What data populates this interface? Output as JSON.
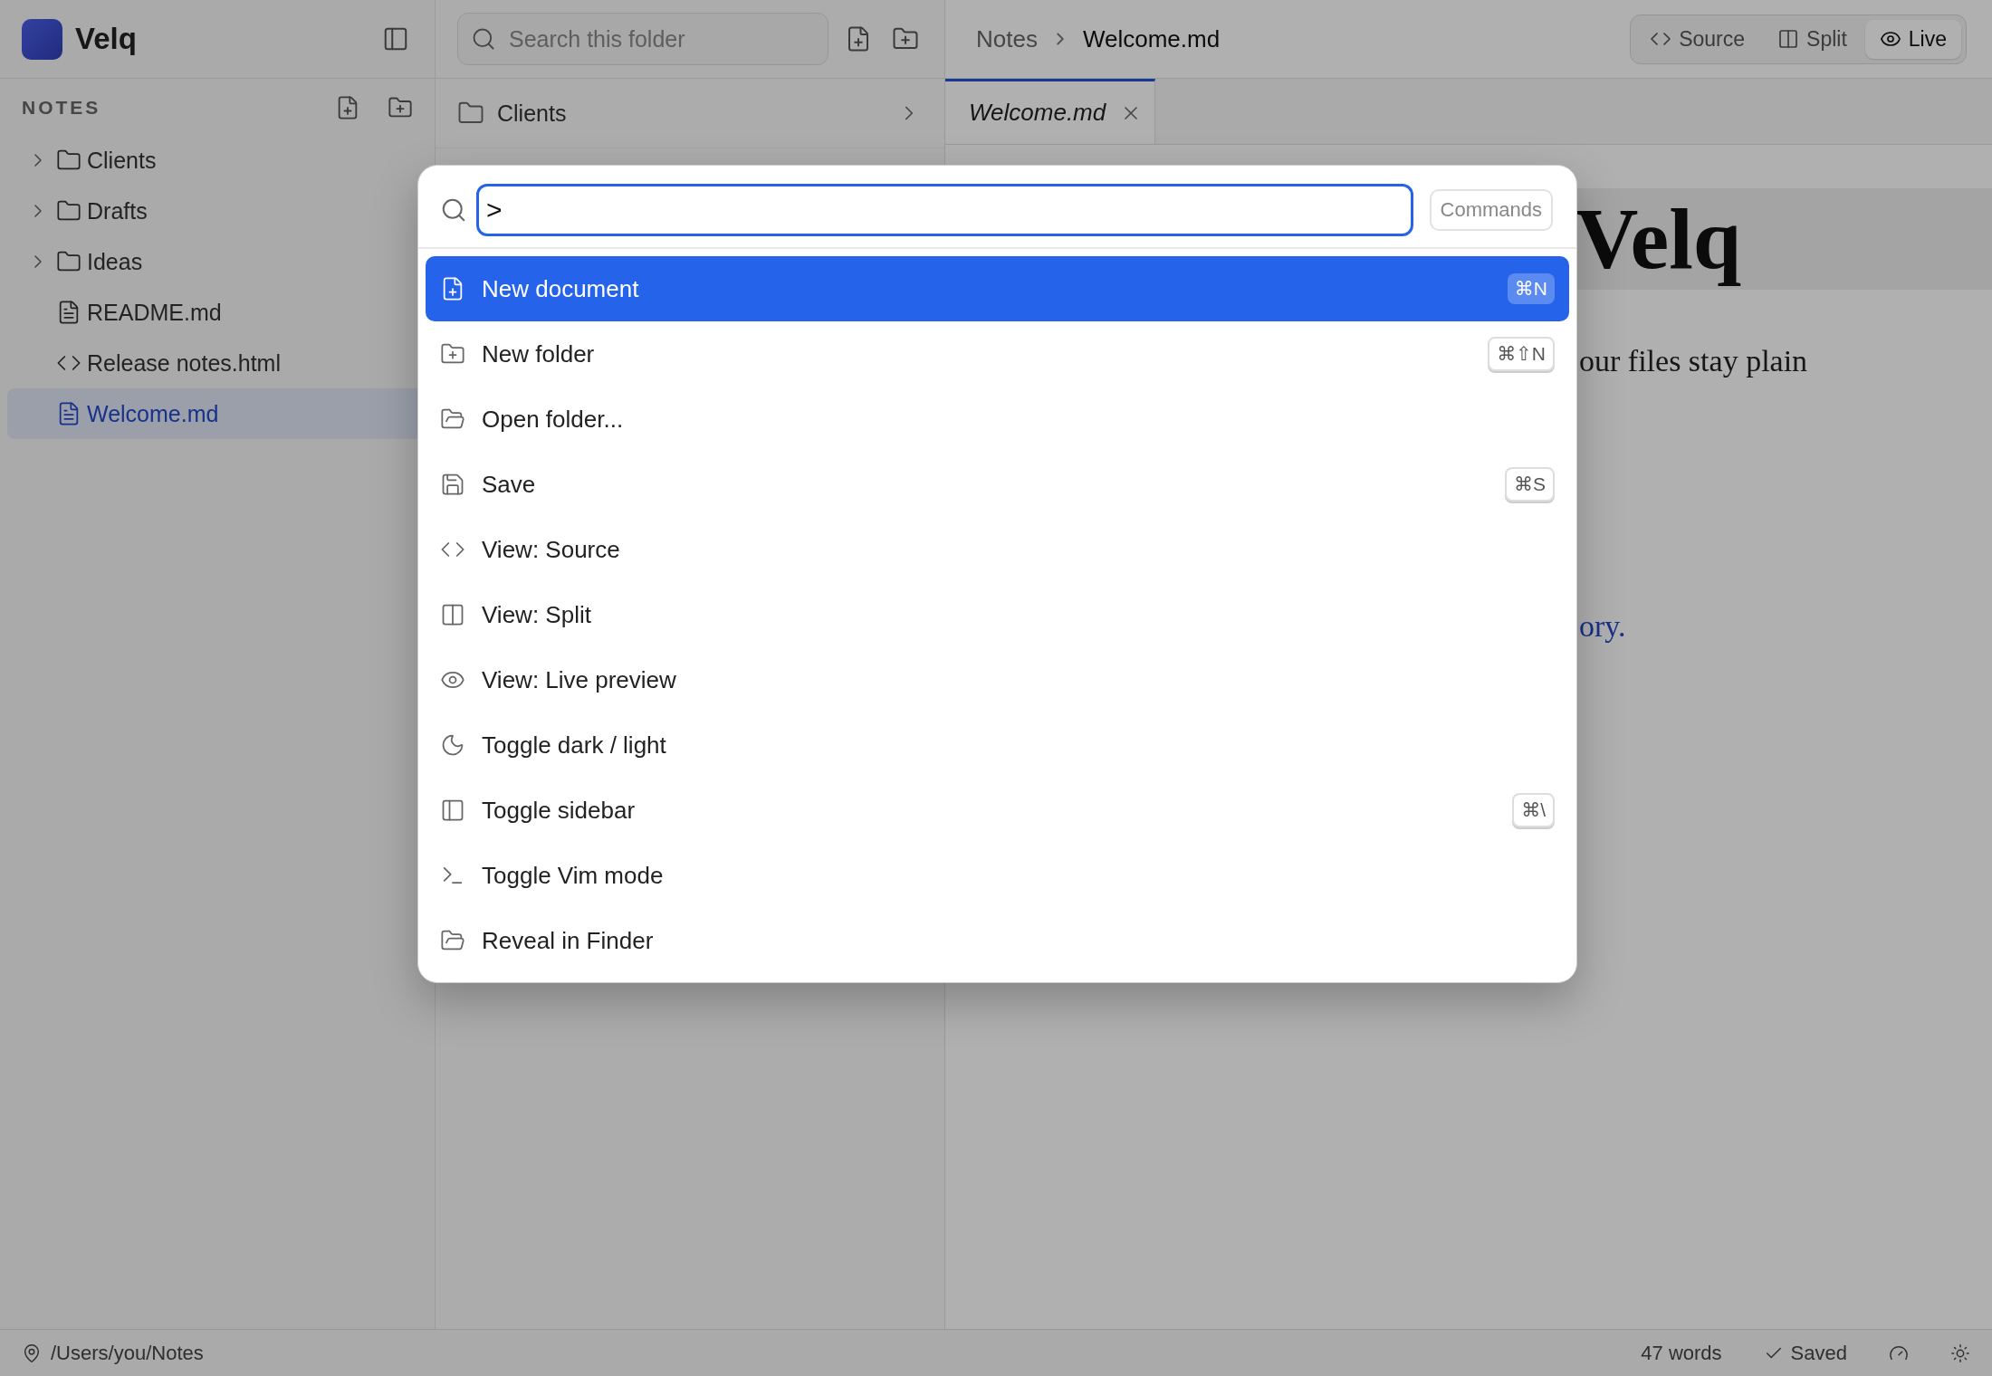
{
  "app": {
    "name": "Velq"
  },
  "sidebar": {
    "section_title": "NOTES",
    "tree": [
      {
        "kind": "folder",
        "label": "Clients",
        "expanded": false,
        "selected": false
      },
      {
        "kind": "folder",
        "label": "Drafts",
        "expanded": false,
        "selected": false
      },
      {
        "kind": "folder",
        "label": "Ideas",
        "expanded": false,
        "selected": false
      },
      {
        "kind": "markdown",
        "label": "README.md",
        "selected": false
      },
      {
        "kind": "html",
        "label": "Release notes.html",
        "selected": false
      },
      {
        "kind": "markdown",
        "label": "Welcome.md",
        "selected": true
      }
    ]
  },
  "folder_list": {
    "search": {
      "placeholder": "Search this folder"
    },
    "items": [
      {
        "label": "Clients"
      }
    ]
  },
  "editor": {
    "breadcrumb": [
      "Notes",
      "Welcome.md"
    ],
    "view_modes": [
      {
        "kind": "source",
        "label": "Source",
        "selected": false
      },
      {
        "kind": "split",
        "label": "Split",
        "selected": false
      },
      {
        "kind": "live",
        "label": "Live",
        "selected": true
      }
    ],
    "tabs": [
      {
        "label": "Welcome.md",
        "selected": true
      }
    ],
    "content": {
      "heading": "Velq",
      "paragraph": "our files stay plain",
      "link": "ory."
    }
  },
  "command_palette": {
    "query": ">",
    "scope": "Commands",
    "commands": [
      {
        "kind": "new-document",
        "label": "New document",
        "shortcut": "⌘N",
        "selected": true
      },
      {
        "kind": "new-folder",
        "label": "New folder",
        "shortcut": "⌘⇧N",
        "selected": false
      },
      {
        "kind": "open-folder",
        "label": "Open folder...",
        "selected": false
      },
      {
        "kind": "save",
        "label": "Save",
        "shortcut": "⌘S",
        "selected": false
      },
      {
        "kind": "source",
        "label": "View: Source",
        "selected": false
      },
      {
        "kind": "split",
        "label": "View: Split",
        "selected": false
      },
      {
        "kind": "live",
        "label": "View: Live preview",
        "selected": false
      },
      {
        "kind": "theme",
        "label": "Toggle dark / light",
        "selected": false
      },
      {
        "kind": "sidebar",
        "label": "Toggle sidebar",
        "shortcut": "⌘\\",
        "selected": false
      },
      {
        "kind": "terminal",
        "label": "Toggle Vim mode",
        "selected": false
      },
      {
        "kind": "reveal",
        "label": "Reveal in Finder",
        "selected": false
      }
    ]
  },
  "status_bar": {
    "path": "/Users/you/Notes",
    "word_count": "47 words",
    "save_state": "Saved"
  }
}
